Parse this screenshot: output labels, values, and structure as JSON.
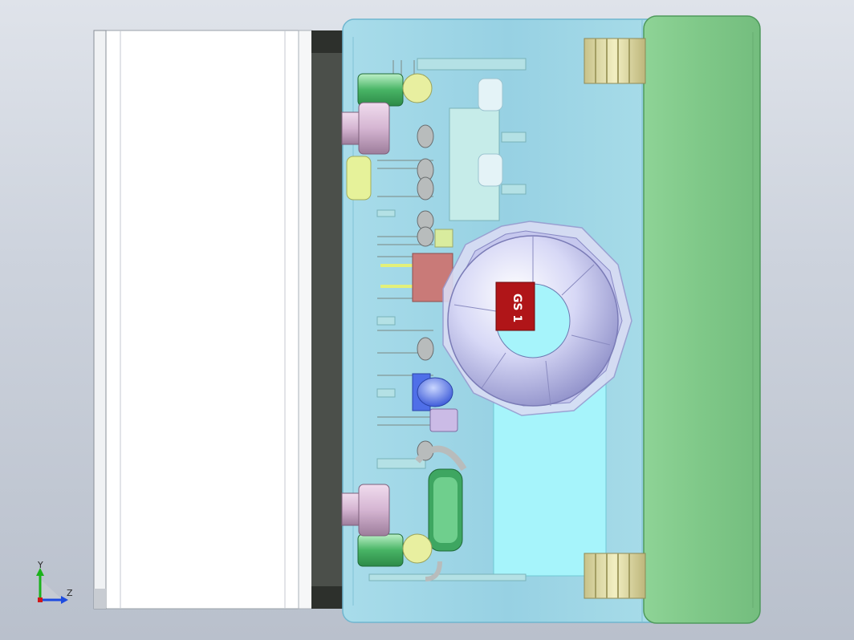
{
  "viewport": {
    "component_marking": "GS 1",
    "colors": {
      "background_top": "#dfe3ea",
      "background_bottom": "#b9c0cc",
      "enclosure_shell": "#9fd6e6",
      "enclosure_outline": "#6fb6cf",
      "end_cap": "#7ec88a",
      "end_cap_outline": "#4f9a5c",
      "white_panel": "#ffffff",
      "gasket": "#4b4f4a",
      "cable_gland": "#cfd1f2",
      "gland_insert": "#b01518",
      "blue_led": "#4f6fe8",
      "pcb_cyan": "#a6f4fb",
      "brass_insert": "#ddd9a5",
      "green_connector": "#7ad08f",
      "pink_standoff": "#d8bcd6",
      "red_block": "#c97a78"
    }
  },
  "triad": {
    "y_label": "Y",
    "z_label": "Z",
    "y_color": "#1bb21b",
    "z_color": "#1d4be0",
    "x_color": "#d01818"
  }
}
